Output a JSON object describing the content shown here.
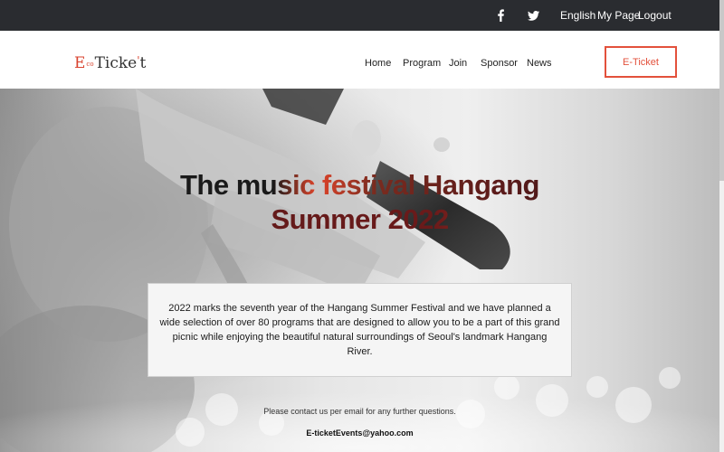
{
  "topbar": {
    "social": [
      "facebook-icon",
      "twitter-icon"
    ],
    "language": "English",
    "mypage": "My Page",
    "logout": "Logout"
  },
  "brand": {
    "logo_first": "E",
    "logo_small": "co",
    "logo_main": "Ticke",
    "logo_apostrophe": "'",
    "logo_last": "t"
  },
  "nav": {
    "items": [
      "Home",
      "Program",
      "Join",
      "Sponsor",
      "News"
    ],
    "cta": "E-Ticket"
  },
  "hero": {
    "title_line1": "The music festival Hangang",
    "title_line2": "Summer 2022",
    "description": "2022 marks the seventh year of the Hangang Summer Festival and we have planned a wide selection of over 80 programs that are designed to allow you to be a part of this grand picnic while enjoying the beautiful natural surroundings of Seoul's landmark Hangang River.",
    "contact_note": "Please contact us per email for any further questions.",
    "contact_email": "E-ticketEvents@yahoo.com"
  },
  "colors": {
    "topbar_bg": "#2a2c30",
    "accent": "#e3513c"
  }
}
